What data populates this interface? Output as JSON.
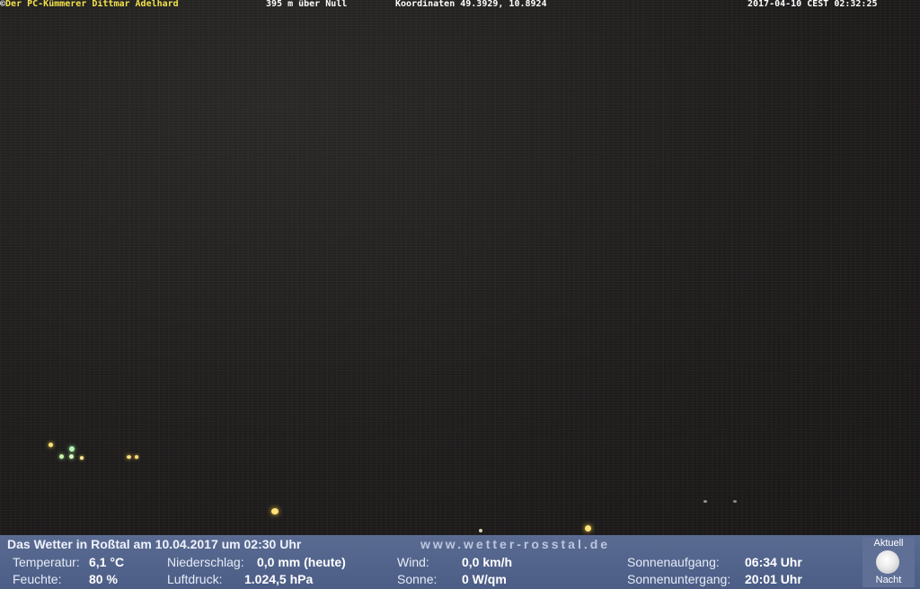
{
  "overlay": {
    "copyright_symbol": "©",
    "author": "Der PC-Kümmerer Dittmar Adelhard",
    "altitude": "395 m über Null",
    "coordinates": "Koordinaten 49.3929, 10.8924",
    "timestamp": "2017-04-10 CEST 02:32:25"
  },
  "weather_panel": {
    "headline": "Das Wetter in Roßtal am 10.04.2017 um 02:30 Uhr",
    "website": "www.wetter-rosstal.de",
    "temperature": {
      "label": "Temperatur:",
      "value": "6,1 °C"
    },
    "humidity": {
      "label": "Feuchte:",
      "value": "80 %"
    },
    "precipitation": {
      "label": "Niederschlag:",
      "value": "0,0 mm (heute)"
    },
    "pressure": {
      "label": "Luftdruck:",
      "value": "1.024,5 hPa"
    },
    "wind": {
      "label": "Wind:",
      "value": "0,0 km/h"
    },
    "sun": {
      "label": "Sonne:",
      "value": "0 W/qm"
    },
    "sunrise": {
      "label": "Sonnenaufgang:",
      "value": "06:34 Uhr"
    },
    "sunset": {
      "label": "Sonnenuntergang:",
      "value": "20:01 Uhr"
    },
    "moon": {
      "top_label": "Aktuell",
      "bottom_label": "Nacht",
      "icon": "full-moon-icon"
    }
  },
  "colors": {
    "overlay_author": "#f2e24a",
    "panel_background": "#52638c",
    "streetlight": "#ffd84a"
  }
}
